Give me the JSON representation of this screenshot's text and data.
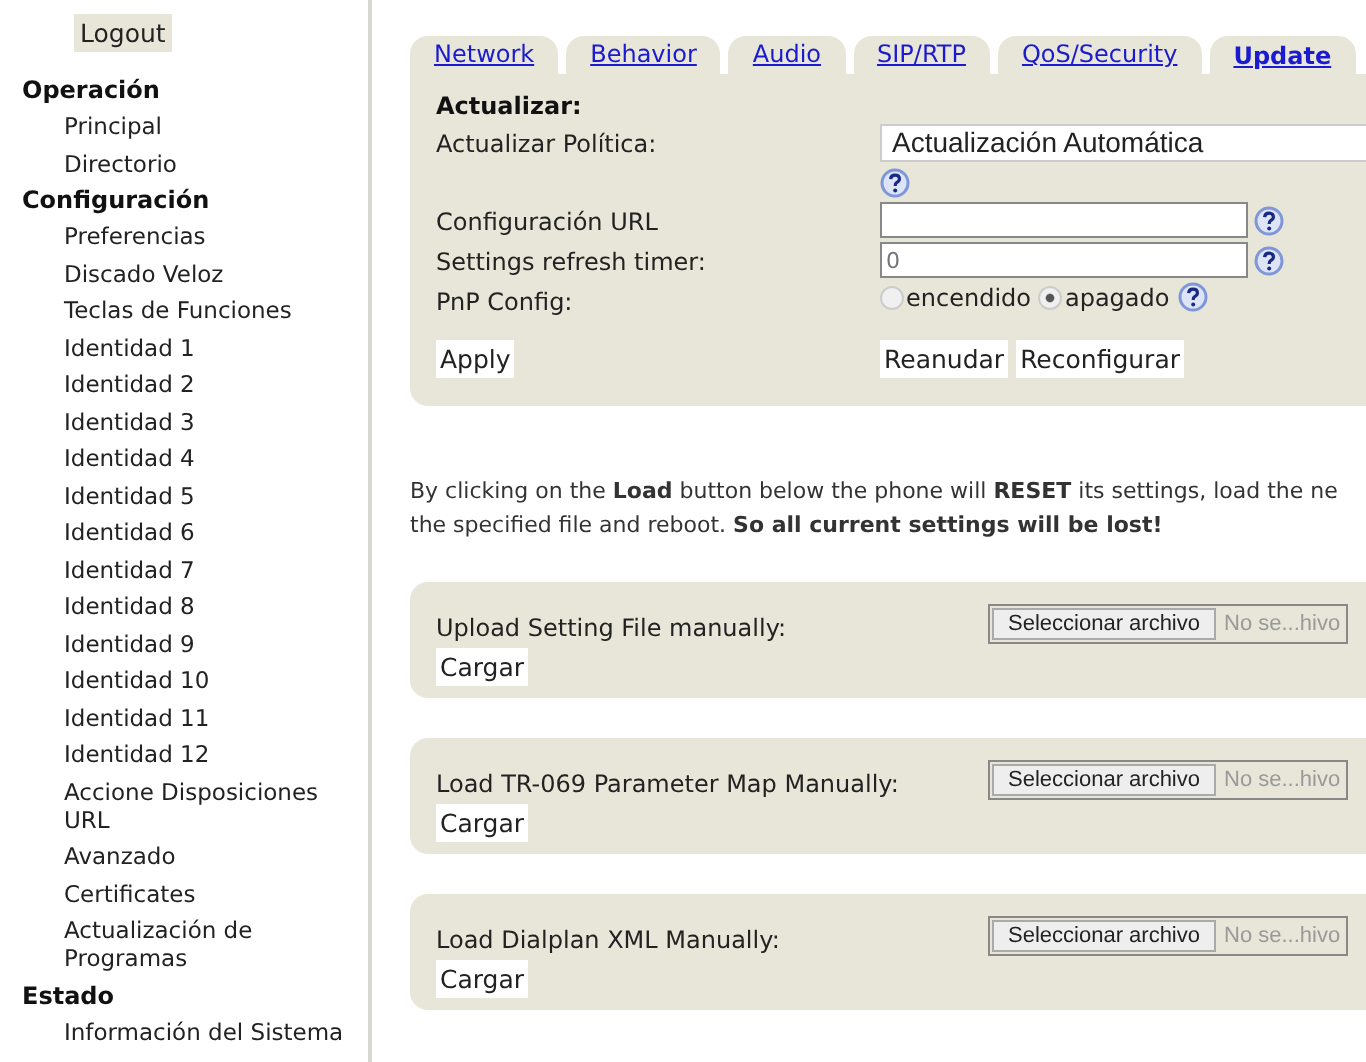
{
  "logout": "Logout",
  "sidebar": {
    "sections": [
      {
        "title": "Operación",
        "items": [
          {
            "label": "Principal"
          },
          {
            "label": "Directorio"
          }
        ]
      },
      {
        "title": "Configuración",
        "items": [
          {
            "label": "Preferencias"
          },
          {
            "label": "Discado Veloz"
          },
          {
            "label": "Teclas de Funciones"
          },
          {
            "label": "Identidad 1"
          },
          {
            "label": "Identidad 2"
          },
          {
            "label": "Identidad 3"
          },
          {
            "label": "Identidad 4"
          },
          {
            "label": "Identidad 5"
          },
          {
            "label": "Identidad 6"
          },
          {
            "label": "Identidad 7"
          },
          {
            "label": "Identidad 8"
          },
          {
            "label": "Identidad 9"
          },
          {
            "label": "Identidad 10"
          },
          {
            "label": "Identidad 11"
          },
          {
            "label": "Identidad 12"
          },
          {
            "label": "Accione Disposiciones URL"
          },
          {
            "label": "Avanzado"
          },
          {
            "label": "Certificates"
          },
          {
            "label": "Actualización de Programas"
          }
        ]
      },
      {
        "title": "Estado",
        "items": [
          {
            "label": "Información del Sistema"
          }
        ]
      }
    ]
  },
  "tabs": [
    {
      "label": "Network",
      "selected": false
    },
    {
      "label": "Behavior",
      "selected": false
    },
    {
      "label": "Audio",
      "selected": false
    },
    {
      "label": "SIP/RTP",
      "selected": false
    },
    {
      "label": "QoS/Security",
      "selected": false
    },
    {
      "label": "Update",
      "selected": true
    }
  ],
  "update": {
    "heading": "Actualizar:",
    "fields": [
      {
        "kind": "select",
        "label": "Actualizar Política:",
        "value": "Actualización Automática"
      },
      {
        "kind": "text",
        "label": "Configuración URL"
      },
      {
        "kind": "text",
        "label": "Settings refresh timer:",
        "placeholder": "0"
      },
      {
        "kind": "radio",
        "label": "PnP Config:",
        "options": [
          {
            "label": "encendido",
            "selected": false
          },
          {
            "label": "apagado",
            "selected": true
          }
        ]
      }
    ],
    "apply": "Apply",
    "actions": [
      "Reanudar",
      "Reconfigurar"
    ]
  },
  "notice": [
    "By clicking on the **Load** button below the phone will **RESET** its settings, load the ne",
    "the specified file and reboot. **So all current settings will be lost!**"
  ],
  "uploads": [
    {
      "label": "Upload Setting File manually:",
      "choose": "Seleccionar archivo",
      "file": "No se...hivo",
      "load": "Cargar"
    },
    {
      "label": "Load TR-069 Parameter Map Manually:",
      "choose": "Seleccionar archivo",
      "file": "No se...hivo",
      "load": "Cargar"
    },
    {
      "label": "Load Dialplan XML Manually:",
      "choose": "Seleccionar archivo",
      "file": "No se...hivo",
      "load": "Cargar"
    }
  ]
}
